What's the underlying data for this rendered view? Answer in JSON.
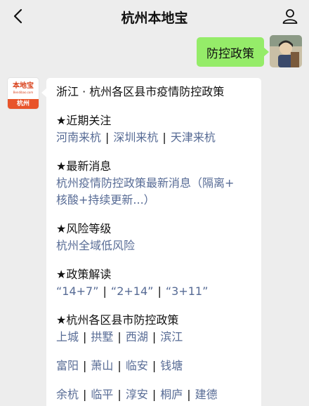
{
  "header": {
    "title": "杭州本地宝"
  },
  "chat": {
    "outgoing_message": "防控政策",
    "bot_avatar": {
      "brand": "本地宝",
      "site": "Bendibao.com",
      "city": "杭州"
    },
    "reply": {
      "headline": "浙江 · 杭州各区县市疫情防控政策",
      "sections": [
        {
          "title": "★近期关注",
          "link_rows": [
            [
              "河南来杭",
              "深圳来杭",
              "天津来杭"
            ]
          ]
        },
        {
          "title": "★最新消息",
          "text_lines": [
            "杭州疫情防控政策最新消息（隔离+",
            "核酸+持续更新...）"
          ]
        },
        {
          "title": "★风险等级",
          "text_lines": [
            "杭州全域低风险"
          ]
        },
        {
          "title": "★政策解读",
          "link_rows": [
            [
              "“14+7”",
              "“2+14”",
              "“3+11”"
            ]
          ]
        },
        {
          "title": "★杭州各区县市防控政策",
          "link_rows": [
            [
              "上城",
              "拱墅",
              "西湖",
              "滨江"
            ],
            [
              "富阳",
              "萧山",
              "临安",
              "钱塘"
            ],
            [
              "余杭",
              "临平",
              "淳安",
              "桐庐",
              "建德"
            ]
          ]
        }
      ]
    }
  }
}
